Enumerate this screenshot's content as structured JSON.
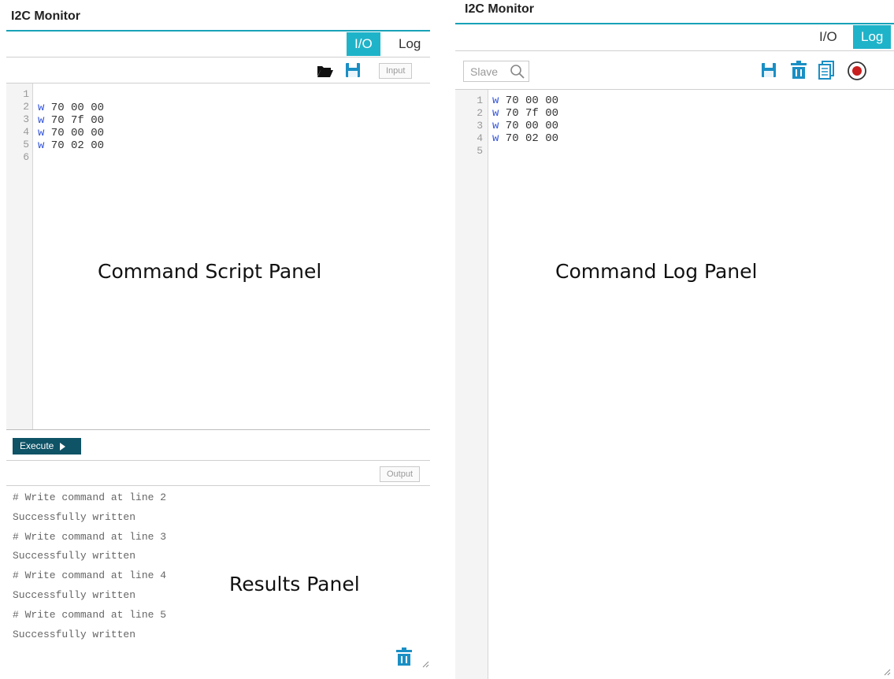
{
  "left_panel": {
    "title": "I2C Monitor",
    "tabs": [
      {
        "label": "I/O",
        "active": true
      },
      {
        "label": "Log",
        "active": false
      }
    ],
    "input_button": "Input",
    "output_button": "Output",
    "execute_button": "Execute",
    "script_line_numbers": [
      "1",
      "2",
      "3",
      "4",
      "5",
      "6"
    ],
    "script_lines": [
      {
        "op": "",
        "args": ""
      },
      {
        "op": "w",
        "args": " 70 00 00"
      },
      {
        "op": "w",
        "args": " 70 7f 00"
      },
      {
        "op": "w",
        "args": " 70 00 00"
      },
      {
        "op": "w",
        "args": " 70 02 00"
      },
      {
        "op": "",
        "args": ""
      }
    ],
    "script_label": "Command Script Panel",
    "results": [
      "# Write command at line 2",
      "Successfully written",
      "# Write command at line 3",
      "Successfully written",
      "# Write command at line 4",
      "Successfully written",
      "# Write command at line 5",
      "Successfully written"
    ],
    "results_label": "Results Panel",
    "toolbar_icons": [
      "folder-open-icon",
      "save-icon"
    ],
    "footer_icons": [
      "trash-icon"
    ]
  },
  "right_panel": {
    "title": "I2C Monitor",
    "tabs": [
      {
        "label": "I/O",
        "active": false
      },
      {
        "label": "Log",
        "active": true
      }
    ],
    "slave_placeholder": "Slave",
    "log_line_numbers": [
      "1",
      "2",
      "3",
      "4",
      "5"
    ],
    "log_lines": [
      {
        "op": "w",
        "args": " 70 00 00"
      },
      {
        "op": "w",
        "args": " 70 7f 00"
      },
      {
        "op": "w",
        "args": " 70 00 00"
      },
      {
        "op": "w",
        "args": " 70 02 00"
      },
      {
        "op": "",
        "args": ""
      }
    ],
    "log_label": "Command Log Panel",
    "toolbar_icons": [
      "save-icon",
      "trash-icon",
      "copy-icon",
      "record-icon"
    ]
  },
  "colors": {
    "accent": "#1fb3c9",
    "execute_bg": "#0e5366",
    "icon_blue": "#1a8fc4",
    "record_red": "#c81e1e",
    "command_blue": "#3355dd"
  }
}
